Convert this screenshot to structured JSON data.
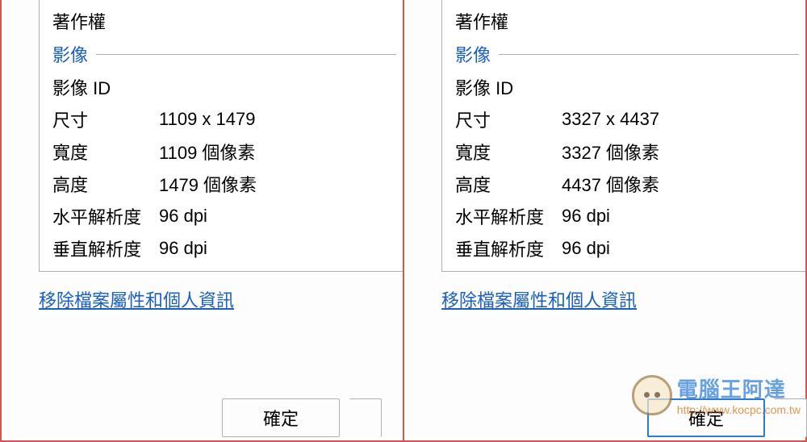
{
  "left": {
    "copyright_label": "著作權",
    "section_image": "影像",
    "image_id_label": "影像 ID",
    "dim_label": "尺寸",
    "dim_value": "1109 x 1479",
    "width_label": "寬度",
    "width_value": "1109 個像素",
    "height_label": "高度",
    "height_value": "1479 個像素",
    "hres_label": "水平解析度",
    "hres_value": "96 dpi",
    "vres_label": "垂直解析度",
    "vres_value": "96 dpi",
    "remove_link": "移除檔案屬性和個人資訊",
    "ok_label": "確定"
  },
  "right": {
    "copyright_label": "著作權",
    "section_image": "影像",
    "image_id_label": "影像 ID",
    "dim_label": "尺寸",
    "dim_value": "3327 x 4437",
    "width_label": "寬度",
    "width_value": "3327 個像素",
    "height_label": "高度",
    "height_value": "4437 個像素",
    "hres_label": "水平解析度",
    "hres_value": "96 dpi",
    "vres_label": "垂直解析度",
    "vres_value": "96 dpi",
    "remove_link": "移除檔案屬性和個人資訊",
    "ok_label": "確定"
  },
  "watermark": {
    "title": "電腦王阿達",
    "url": "http://www.kocpc.com.tw"
  }
}
